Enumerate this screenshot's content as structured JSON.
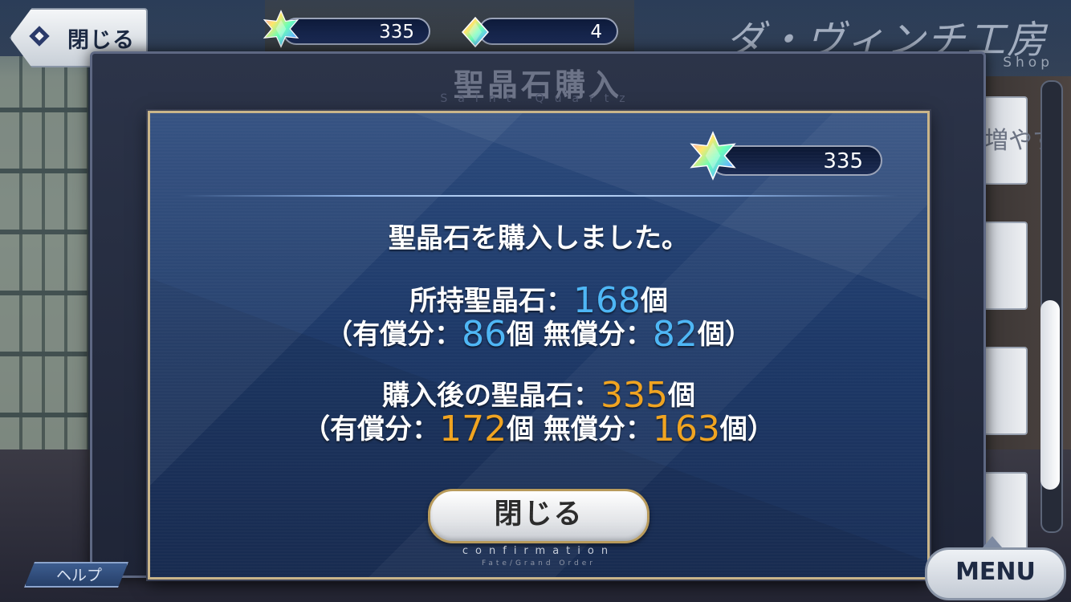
{
  "header": {
    "close_label": "閉じる",
    "saint_quartz_count": "335",
    "quartz_fragment_count": "4",
    "shop_title": "ダ・ヴィンチ工房",
    "shop_subtitle": "Shop"
  },
  "panel": {
    "title": "聖晶石購入",
    "subtitle": "Saint Quartz"
  },
  "dialog": {
    "quartz_count": "335",
    "message": "聖晶石を購入しました。",
    "owned_label": "所持聖晶石：",
    "owned_total": "168",
    "unit": "個",
    "paid_label": "（有償分：",
    "free_label": "無償分：",
    "close_paren": "）",
    "owned_paid": "86",
    "owned_free": "82",
    "after_label": "購入後の聖晶石：",
    "after_total": "335",
    "after_paid": "172",
    "after_free": "163",
    "close_button": "閉じる",
    "footer": "confirmation",
    "footer_sub": "Fate/Grand Order"
  },
  "side": {
    "partial_text": "増やす"
  },
  "bottom": {
    "help_label": "ヘルプ",
    "menu_label": "MENU"
  },
  "colors": {
    "owned_accent": "#4db6f5",
    "after_accent": "#f0a31f",
    "frame_gold": "#c9b58a"
  },
  "icons": [
    "saint-quartz-icon",
    "quartz-fragment-icon",
    "back-chevron-icon"
  ]
}
